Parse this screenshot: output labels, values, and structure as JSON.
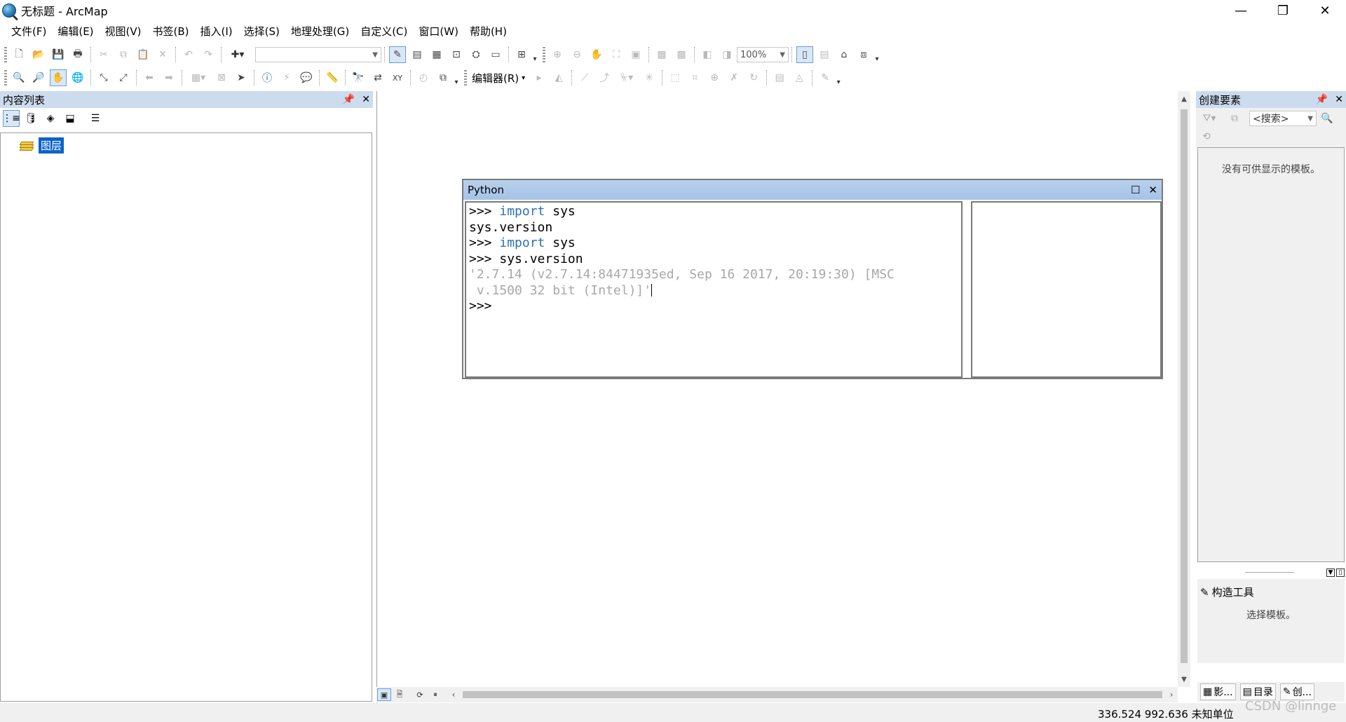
{
  "window": {
    "title": "无标题 - ArcMap",
    "min": "—",
    "restore": "❐",
    "close": "✕"
  },
  "menu": [
    "文件(F)",
    "编辑(E)",
    "视图(V)",
    "书签(B)",
    "插入(I)",
    "选择(S)",
    "地理处理(G)",
    "自定义(C)",
    "窗口(W)",
    "帮助(H)"
  ],
  "toolbar": {
    "scale_value": "",
    "zoom_value": "100%",
    "editor_label": "编辑器(R)"
  },
  "toc": {
    "title": "内容列表",
    "layer_label": "图层"
  },
  "python": {
    "title": "Python",
    "lines": [
      {
        "prompt": ">>> ",
        "kw": "import",
        "rest": " sys"
      },
      {
        "prompt": "",
        "kw": "",
        "rest": "sys.version"
      },
      {
        "prompt": ">>> ",
        "kw": "import",
        "rest": " sys"
      },
      {
        "prompt": ">>> ",
        "kw": "",
        "rest": "sys.version"
      }
    ],
    "output_line1": "'2.7.14 (v2.7.14:84471935ed, Sep 16 2017, 20:19:30) [MSC",
    "output_line2": " v.1500 32 bit (Intel)]'",
    "last_prompt": ">>>"
  },
  "create_features": {
    "title": "创建要素",
    "search_placeholder": "<搜索>",
    "empty_message": "没有可供显示的模板。",
    "construction_title": "构造工具",
    "construction_message": "选择模板。",
    "tabs": [
      "影...",
      "目录",
      "创..."
    ]
  },
  "status": {
    "coordinates": "336.524  992.636 未知单位"
  },
  "watermark": "CSDN @linnge"
}
